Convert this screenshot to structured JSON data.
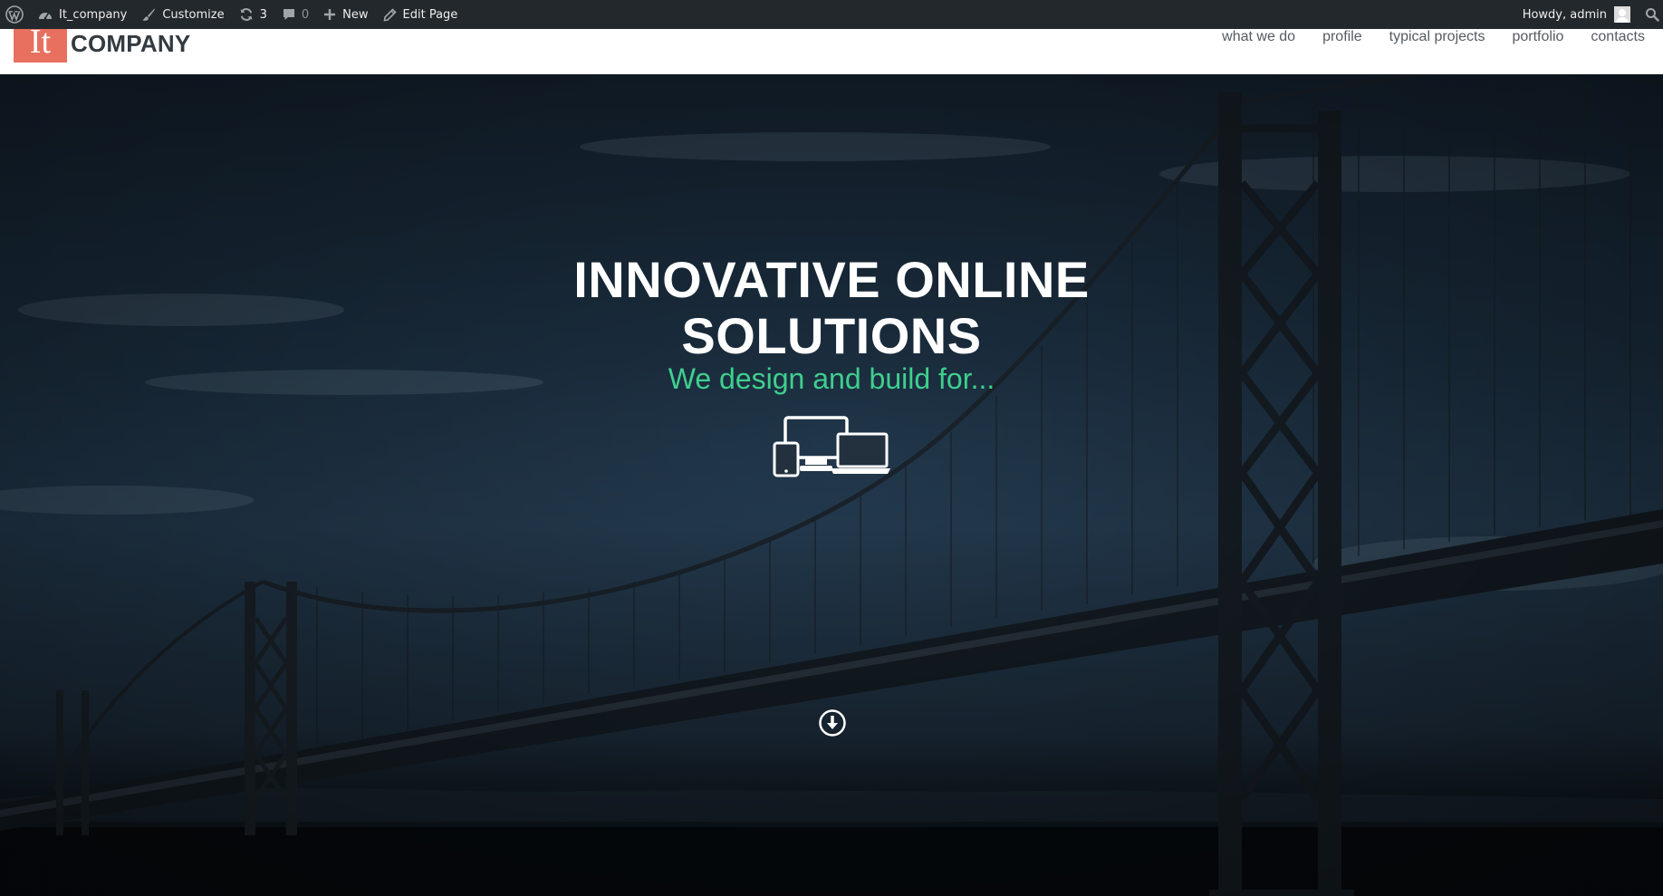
{
  "adminbar": {
    "site_name": "It_company",
    "customize": "Customize",
    "updates_count": "3",
    "comments_count": "0",
    "new": "New",
    "edit_page": "Edit Page",
    "howdy": "Howdy, admin"
  },
  "header": {
    "logo_mark": "It",
    "logo_text": "COMPANY",
    "nav": [
      "what we do",
      "profile",
      "typical projects",
      "portfolio",
      "contacts"
    ]
  },
  "hero": {
    "title_line1": "INNOVATIVE ONLINE",
    "title_line2": "SOLUTIONS",
    "subtitle": "We design and build for...",
    "subtitle_color": "#3fcf8e"
  },
  "colors": {
    "adminbar_bg": "#23282d",
    "logo_bg": "#e8705f",
    "header_bg": "#ffffff"
  },
  "icons": {
    "wp": "wordpress-logo-icon",
    "site": "dashboard-icon",
    "customize": "brush-icon",
    "updates": "refresh-icon",
    "comments": "comment-icon",
    "new": "plus-icon",
    "edit": "pencil-icon",
    "search": "search-icon",
    "devices": "devices-icon",
    "scroll": "arrow-down-circle-icon"
  }
}
